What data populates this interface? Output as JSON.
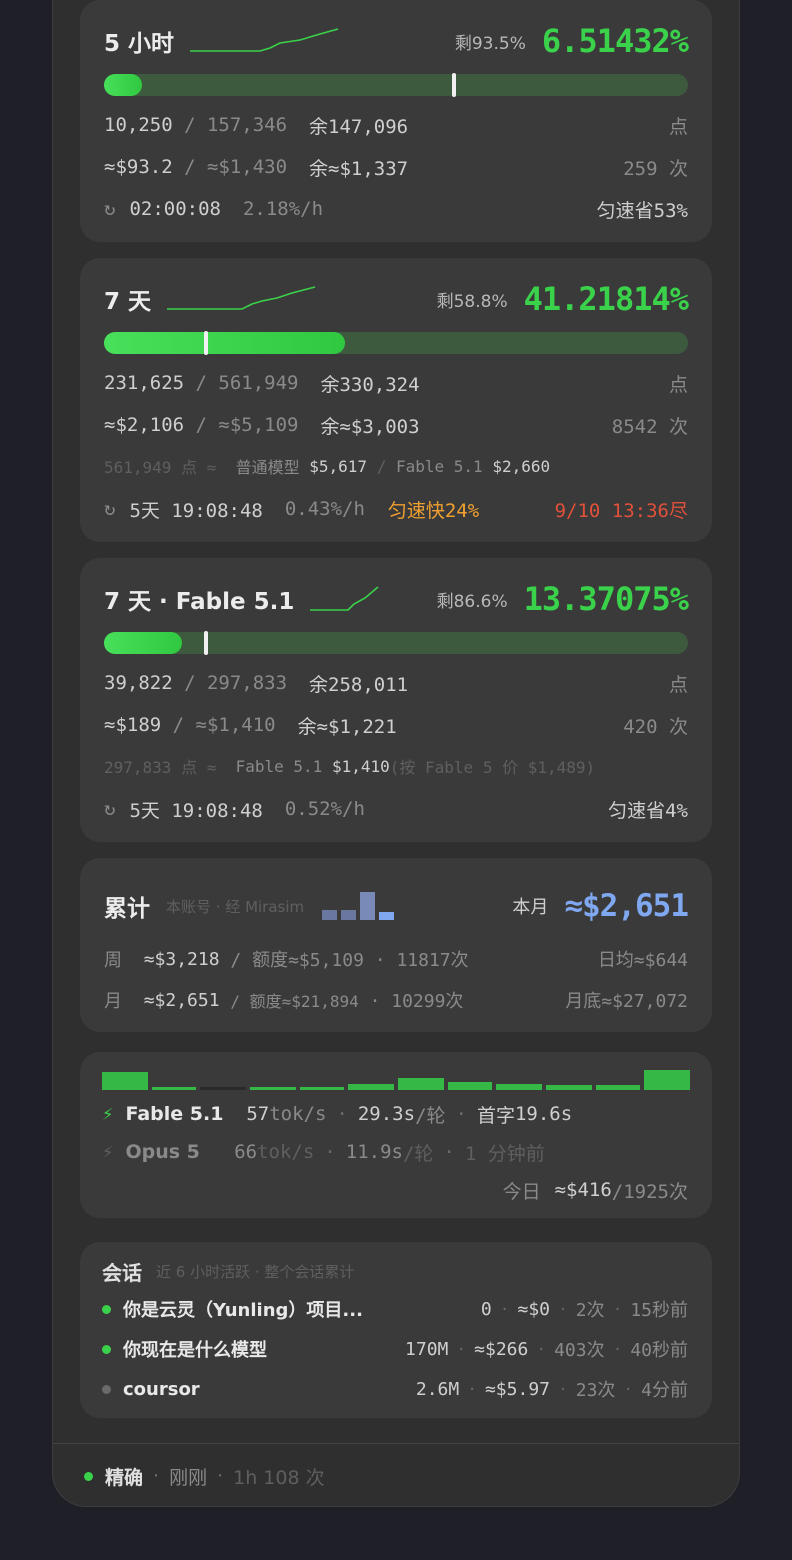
{
  "card_5h": {
    "title": "5 小时",
    "remain": "剩93.5%",
    "percent": "6.51432%",
    "used": "10,250",
    "total": "/ 157,346",
    "left": "余147,096",
    "unit": "点",
    "cost": "≈$93.2",
    "cost_total": "/ ≈$1,430",
    "cost_left": "余≈$1,337",
    "count": "259 次",
    "reset_icon": "reset-icon",
    "timer": "02:00:08",
    "rate": "2.18%/h",
    "pace": "匀速省53%",
    "progress": 0.065,
    "marker": 0.6
  },
  "card_7d": {
    "title": "7 天",
    "remain": "剩58.8%",
    "percent": "41.21814%",
    "used": "231,625",
    "total": "/ 561,949",
    "left": "余330,324",
    "unit": "点",
    "cost": "≈$2,106",
    "cost_total": "/ ≈$5,109",
    "cost_left": "余≈$3,003",
    "count": "8542 次",
    "breakdown_pts": "561,949 点 ≈",
    "breakdown_model": "普通模型",
    "breakdown_model_val": "$5,617",
    "breakdown_sep": "/",
    "breakdown_fable": "Fable 5.1",
    "breakdown_fable_val": "$2,660",
    "timer": "5天 19:08:48",
    "rate": "0.43%/h",
    "pace": "匀速快24%",
    "exhaust": "9/10 13:36尽",
    "progress": 0.412,
    "marker": 0.175
  },
  "card_fable": {
    "title": "7 天 · Fable 5.1",
    "remain": "剩86.6%",
    "percent": "13.37075%",
    "used": "39,822",
    "total": "/ 297,833",
    "left": "余258,011",
    "unit": "点",
    "cost": "≈$189",
    "cost_total": "/ ≈$1,410",
    "cost_left": "余≈$1,221",
    "count": "420 次",
    "breakdown_pts": "297,833 点 ≈",
    "breakdown_fable": "Fable 5.1",
    "breakdown_fable_val": "$1,410",
    "breakdown_note": "(按 Fable 5 价 $1,489)",
    "timer": "5天 19:08:48",
    "rate": "0.52%/h",
    "pace": "匀速省4%",
    "progress": 0.134,
    "marker": 0.175
  },
  "cumulative": {
    "title": "累计",
    "sub": "本账号 · 经 Mirasim",
    "month_label": "本月",
    "month_value": "≈$2,651",
    "week_label": "周",
    "week_cost": "≈$3,218",
    "week_quota": "/ 额度≈$5,109",
    "week_count": "· 11817次",
    "daily_avg": "日均≈$644",
    "mon_label": "月",
    "mon_cost": "≈$2,651",
    "mon_quota": "/ 额度≈$21,894",
    "mon_count": "· 10299次",
    "mon_end": "月底≈$27,072"
  },
  "speed": {
    "m1_name": "Fable 5.1",
    "m1_tok": "57",
    "tok_unit": "tok/s",
    "m1_sec": "29.3s",
    "per_round": "/轮",
    "first_label": "首字",
    "m1_first": "19.6s",
    "m2_name": "Opus 5",
    "m2_tok": "66",
    "m2_sec": "11.9s",
    "m2_ago": "1 分钟前",
    "today_label": "今日",
    "today_cost": "≈$416",
    "today_count": "/1925次"
  },
  "sessions": {
    "title": "会话",
    "sub": "近 6 小时活跃 · 整个会话累计",
    "items": [
      {
        "name": "你是云灵（Yunling）项目...",
        "tokens": "0",
        "cost": "≈$0",
        "count": "2次",
        "ago": "15秒前"
      },
      {
        "name": "你现在是什么模型",
        "tokens": "170M",
        "cost": "≈$266",
        "count": "403次",
        "ago": "40秒前"
      },
      {
        "name": "coursor",
        "tokens": "2.6M",
        "cost": "≈$5.97",
        "count": "23次",
        "ago": "4分前"
      }
    ]
  },
  "footer": {
    "status": "精确",
    "updated": "刚刚",
    "window": "1h 108 次"
  },
  "colors": {
    "green": "#3ad24a",
    "orange": "#f0a030",
    "red": "#e0503a",
    "blue": "#7fa8f0"
  }
}
